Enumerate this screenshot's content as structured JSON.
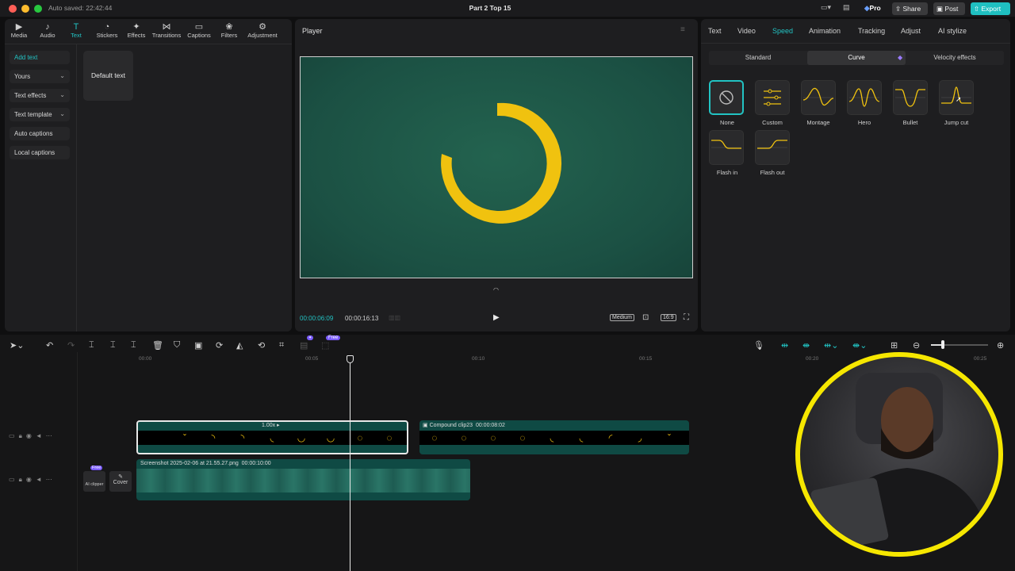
{
  "titlebar": {
    "autosave": "Auto saved: 22:42:44",
    "project_title": "Part 2 Top 15",
    "pro_label": "Pro",
    "share_label": "Share",
    "post_label": "Post",
    "export_label": "Export"
  },
  "toolbar_tabs": [
    {
      "label": "Media",
      "icon": "media-icon"
    },
    {
      "label": "Audio",
      "icon": "audio-icon"
    },
    {
      "label": "Text",
      "icon": "text-icon"
    },
    {
      "label": "Stickers",
      "icon": "stickers-icon"
    },
    {
      "label": "Effects",
      "icon": "effects-icon"
    },
    {
      "label": "Transitions",
      "icon": "transitions-icon"
    },
    {
      "label": "Captions",
      "icon": "captions-icon"
    },
    {
      "label": "Filters",
      "icon": "filters-icon"
    },
    {
      "label": "Adjustment",
      "icon": "adjustment-icon"
    }
  ],
  "text_sidebar": [
    "Add text",
    "Yours",
    "Text effects",
    "Text template",
    "Auto captions",
    "Local captions"
  ],
  "text_default_card": "Default text",
  "player": {
    "title": "Player",
    "current_time": "00:00:06:09",
    "total_time": "00:00:16:13",
    "quality": "Medium",
    "ratio": "16:9"
  },
  "right_tabs": [
    "Text",
    "Video",
    "Speed",
    "Animation",
    "Tracking",
    "Adjust",
    "AI stylize"
  ],
  "speed_subtabs": [
    "Standard",
    "Curve",
    "Velocity effects"
  ],
  "curve_presets": [
    "None",
    "Custom",
    "Montage",
    "Hero",
    "Bullet",
    "Jump cut",
    "Flash in",
    "Flash out"
  ],
  "timeline": {
    "ruler": [
      "00:00",
      "00:05",
      "00:10",
      "00:15",
      "00:20",
      "00:25"
    ],
    "clip1_speed": "1.00x",
    "clip2_label": "Compound clip23",
    "clip2_duration": "00:00:08:02",
    "clip3_label": "Screenshot 2025-02-06 at 21.55.27.png",
    "clip3_duration": "00:00:10:00",
    "free_badge": "Free",
    "ai_clipper": "AI clipper",
    "cover": "Cover"
  },
  "colors": {
    "accent": "#22c3c3",
    "ring": "#f0c20f",
    "canvas": "#1d5a4c"
  }
}
